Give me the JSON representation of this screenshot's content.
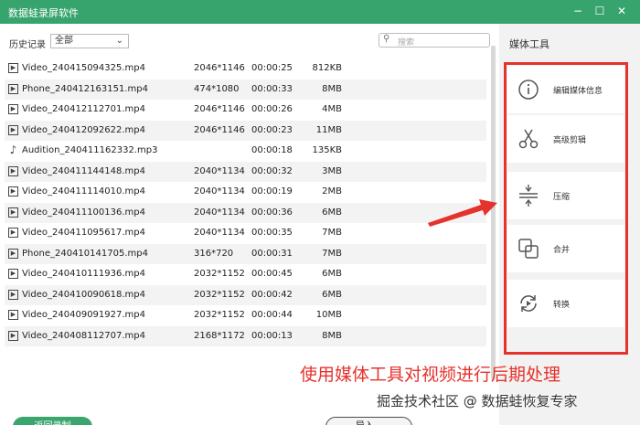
{
  "window": {
    "title": "数据蛙录屏软件",
    "controls": {
      "minimize": "−",
      "maximize": "☐",
      "close": "✕"
    }
  },
  "filter": {
    "label": "历史记录",
    "selected": "全部",
    "search_placeholder": "搜索"
  },
  "files": [
    {
      "type": "video",
      "name": "Video_240415094325.mp4",
      "resolution": "2046*1146",
      "duration": "00:00:25",
      "size": "812KB"
    },
    {
      "type": "video",
      "name": "Phone_240412163151.mp4",
      "resolution": "474*1080",
      "duration": "00:00:33",
      "size": "8MB"
    },
    {
      "type": "video",
      "name": "Video_240412112701.mp4",
      "resolution": "2046*1146",
      "duration": "00:00:26",
      "size": "4MB"
    },
    {
      "type": "video",
      "name": "Video_240412092622.mp4",
      "resolution": "2046*1146",
      "duration": "00:00:23",
      "size": "11MB"
    },
    {
      "type": "audio",
      "name": "Audition_240411162332.mp3",
      "resolution": "",
      "duration": "00:00:18",
      "size": "135KB"
    },
    {
      "type": "video",
      "name": "Video_240411144148.mp4",
      "resolution": "2040*1134",
      "duration": "00:00:32",
      "size": "3MB"
    },
    {
      "type": "video",
      "name": "Video_240411114010.mp4",
      "resolution": "2040*1134",
      "duration": "00:00:19",
      "size": "2MB"
    },
    {
      "type": "video",
      "name": "Video_240411100136.mp4",
      "resolution": "2040*1134",
      "duration": "00:00:36",
      "size": "6MB"
    },
    {
      "type": "video",
      "name": "Video_240411095617.mp4",
      "resolution": "2040*1134",
      "duration": "00:00:35",
      "size": "7MB"
    },
    {
      "type": "video",
      "name": "Phone_240410141705.mp4",
      "resolution": "316*720",
      "duration": "00:00:31",
      "size": "7MB"
    },
    {
      "type": "video",
      "name": "Video_240410111936.mp4",
      "resolution": "2032*1152",
      "duration": "00:00:45",
      "size": "6MB"
    },
    {
      "type": "video",
      "name": "Video_240410090618.mp4",
      "resolution": "2032*1152",
      "duration": "00:00:42",
      "size": "6MB"
    },
    {
      "type": "video",
      "name": "Video_240409091927.mp4",
      "resolution": "2032*1152",
      "duration": "00:00:44",
      "size": "10MB"
    },
    {
      "type": "video",
      "name": "Video_240408112707.mp4",
      "resolution": "2168*1172",
      "duration": "00:00:13",
      "size": "8MB"
    }
  ],
  "buttons": {
    "back": "返回录制",
    "import": "导入"
  },
  "media_tools": {
    "title": "媒体工具",
    "items": [
      {
        "label": "编辑媒体信息",
        "icon": "info-icon"
      },
      {
        "label": "高级剪辑",
        "icon": "scissors-icon"
      },
      {
        "label": "压缩",
        "icon": "compress-icon"
      },
      {
        "label": "合并",
        "icon": "merge-icon"
      },
      {
        "label": "转换",
        "icon": "convert-icon"
      }
    ]
  },
  "annotation": {
    "caption": "使用媒体工具对视频进行后期处理",
    "watermark": "掘金技术社区 @ 数据蛙恢复专家",
    "highlight_color": "#e6322c"
  },
  "colors": {
    "accent": "#37a46d",
    "highlight": "#e6322c"
  }
}
